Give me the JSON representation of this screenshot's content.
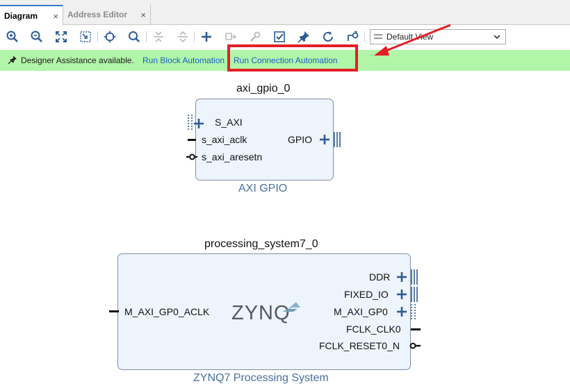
{
  "tabs": [
    {
      "label": "Diagram",
      "close": "×"
    },
    {
      "label": "Address Editor",
      "close": "×"
    }
  ],
  "toolbar": {
    "icons": [
      "zoom-in-icon",
      "zoom-out-icon",
      "fit-view-icon",
      "zoom-area-icon",
      "autofit-selection-icon",
      "search-icon",
      "collapse-icon",
      "expand-icon",
      "add-ip-icon",
      "make-external-icon",
      "properties-wrench-icon",
      "validate-design-icon",
      "pin-icon",
      "regenerate-layout-icon",
      "optimize-routing-icon"
    ],
    "view_select": {
      "value": "Default View"
    }
  },
  "assistance": {
    "message": "Designer Assistance available.",
    "run_block_automation": "Run Block Automation",
    "run_connection_automation": "Run Connection Automation"
  },
  "blocks": {
    "gpio": {
      "instance_name": "axi_gpio_0",
      "ip_name": "AXI GPIO",
      "left_ports": [
        "S_AXI",
        "s_axi_aclk",
        "s_axi_aresetn"
      ],
      "right_ports": [
        "GPIO"
      ]
    },
    "ps7": {
      "instance_name": "processing_system7_0",
      "ip_name": "ZYNQ7 Processing System",
      "logo": "ZYNQ",
      "left_ports": [
        "M_AXI_GP0_ACLK"
      ],
      "right_ports": [
        "DDR",
        "FIXED_IO",
        "M_AXI_GP0",
        "FCLK_CLK0",
        "FCLK_RESET0_N"
      ]
    }
  },
  "colors": {
    "assist_bar": "#b1f5a8",
    "link": "#1a5fc2",
    "annotation_red": "#e41e26",
    "block_fill": "#eef4fb",
    "port_blue": "#2d5b95"
  }
}
